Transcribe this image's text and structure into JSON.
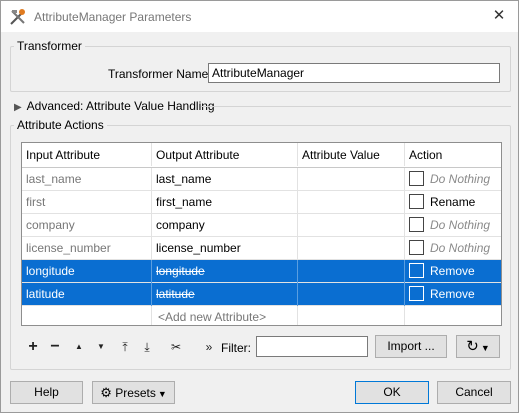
{
  "window": {
    "title": "AttributeManager Parameters",
    "close_glyph": "✕"
  },
  "transformer": {
    "group_title": "Transformer",
    "name_label": "Transformer Name:",
    "name_value": "AttributeManager"
  },
  "advanced": {
    "label": "Advanced: Attribute Value Handling"
  },
  "attribute_actions": {
    "group_title": "Attribute Actions",
    "columns": [
      "Input Attribute",
      "Output Attribute",
      "Attribute Value",
      "Action"
    ],
    "rows": [
      {
        "input": "last_name",
        "output": "last_name",
        "value": "",
        "action": "Do Nothing"
      },
      {
        "input": "first",
        "output": "first_name",
        "value": "",
        "action": "Rename"
      },
      {
        "input": "company",
        "output": "company",
        "value": "",
        "action": "Do Nothing"
      },
      {
        "input": "license_number",
        "output": "license_number",
        "value": "",
        "action": "Do Nothing"
      },
      {
        "input": "longitude",
        "output": "longitude",
        "value": "",
        "action": "Remove"
      },
      {
        "input": "latitude",
        "output": "latitude",
        "value": "",
        "action": "Remove"
      }
    ],
    "add_placeholder": "<Add new Attribute>"
  },
  "toolbar": {
    "add_glyph": "+",
    "remove_glyph": "−",
    "move_up_glyph": "▲",
    "move_down_glyph": "▼",
    "move_top_glyph": "⤒",
    "move_bottom_glyph": "⤓",
    "cut_glyph": "✂",
    "more_glyph": "»",
    "filter_label": "Filter:",
    "filter_value": "",
    "import_label": "Import ...",
    "refresh_glyph": "↻"
  },
  "footer": {
    "help_label": "Help",
    "presets_label": "Presets",
    "ok_label": "OK",
    "cancel_label": "Cancel"
  },
  "colors": {
    "selection": "#0a6ed1",
    "ok_border": "#0078d7"
  }
}
